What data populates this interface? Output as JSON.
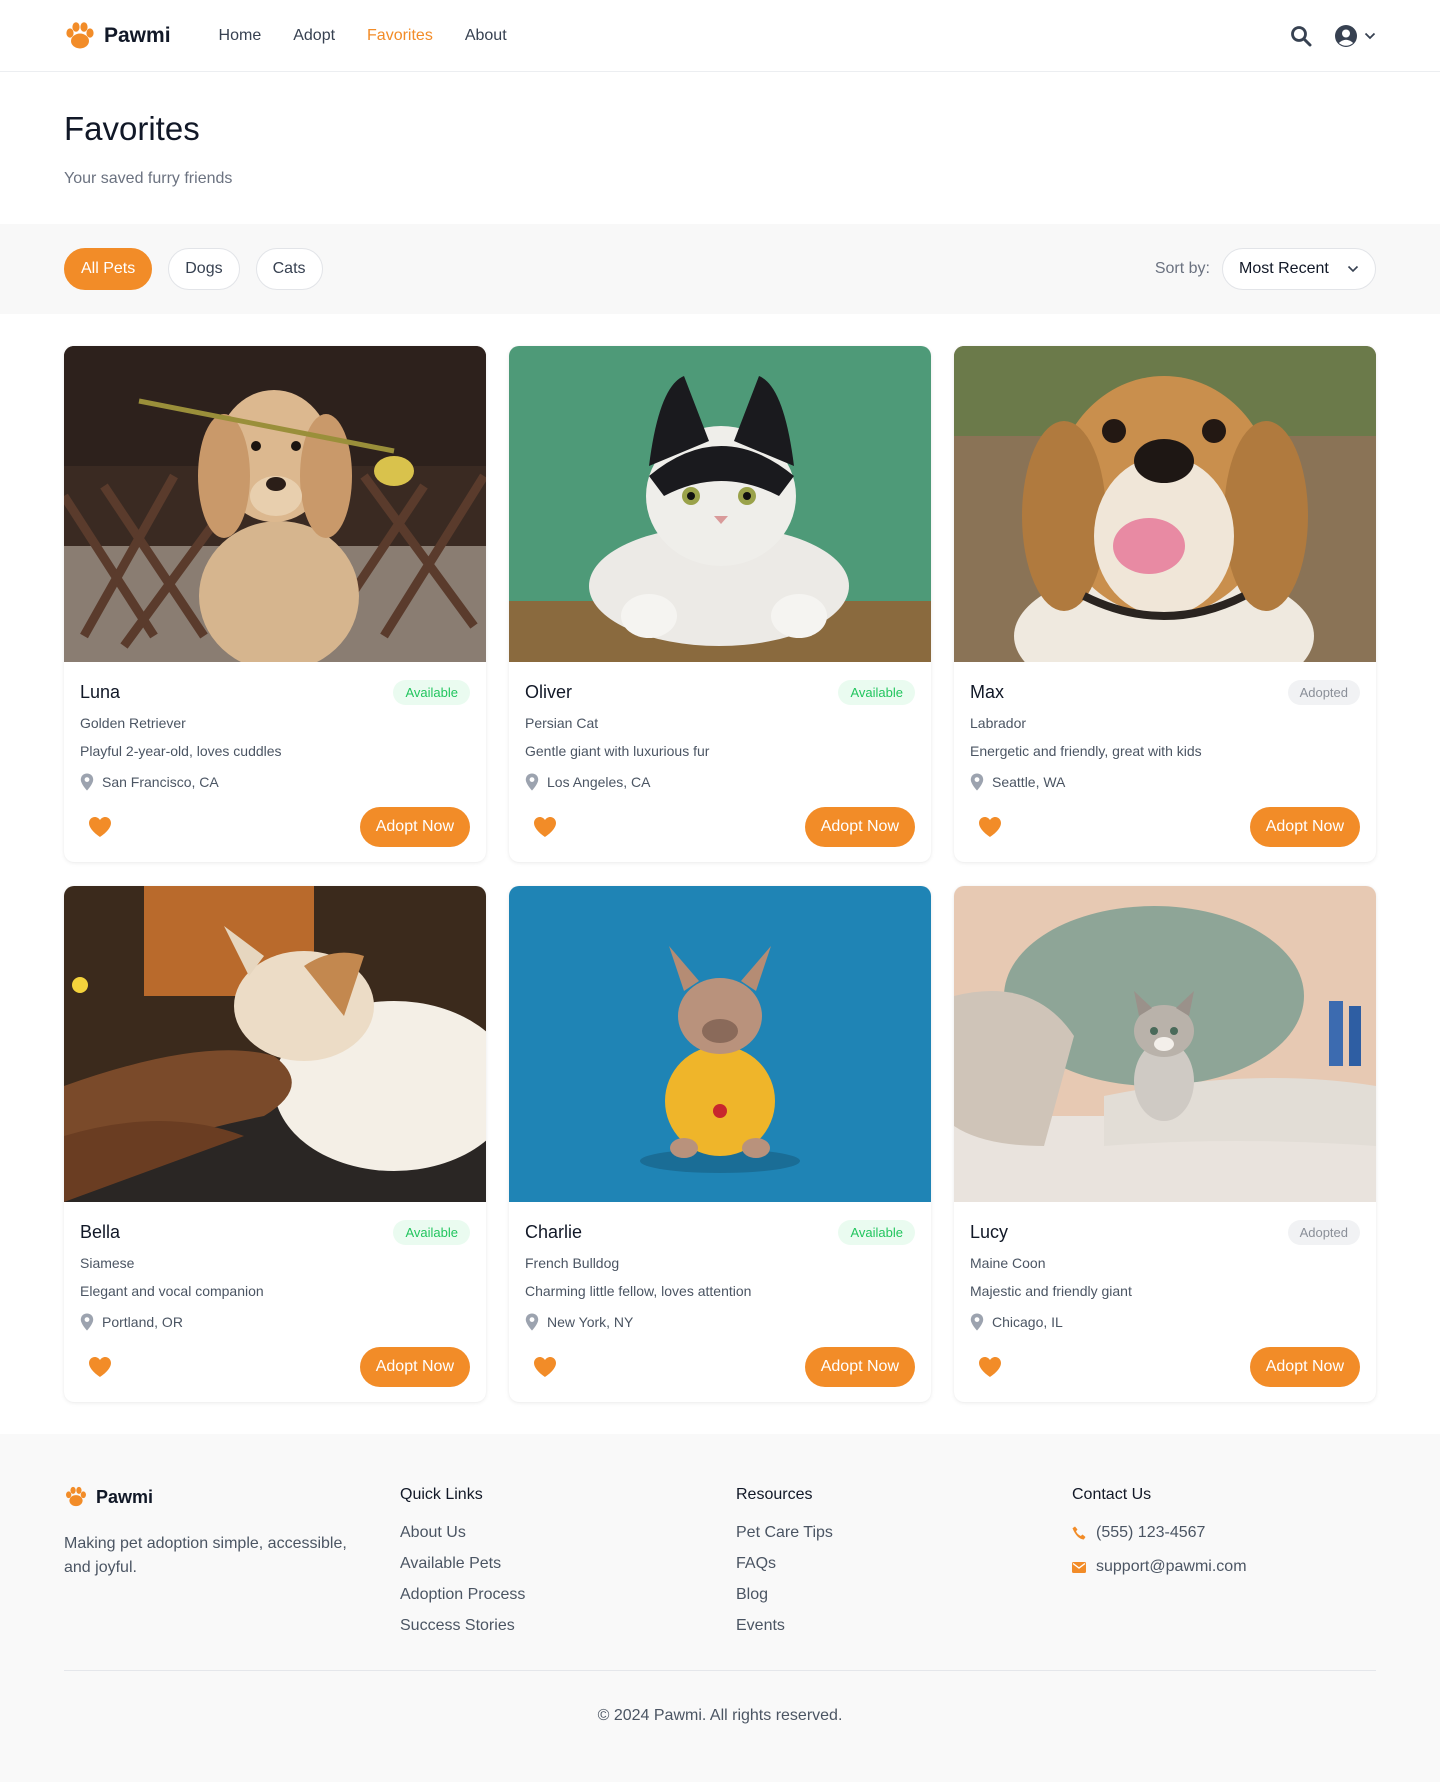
{
  "brand": {
    "name": "Pawmi",
    "accent": "#f28c28"
  },
  "nav": {
    "items": [
      "Home",
      "Adopt",
      "Favorites",
      "About"
    ],
    "active": "Favorites"
  },
  "header": {
    "search_icon": "search-icon",
    "user_icon": "user-circle-icon"
  },
  "page": {
    "title": "Favorites",
    "subtitle": "Your saved furry friends"
  },
  "filters": {
    "items": [
      "All Pets",
      "Dogs",
      "Cats"
    ],
    "active": "All Pets"
  },
  "sort": {
    "label": "Sort by:",
    "value": "Most Recent"
  },
  "pets": [
    {
      "name": "Luna",
      "status": "Available",
      "breed": "Golden Retriever",
      "description": "Playful 2-year-old, loves cuddles",
      "location": "San Francisco, CA",
      "action": "Adopt Now",
      "image": "golden-dog-with-flower"
    },
    {
      "name": "Oliver",
      "status": "Available",
      "breed": "Persian Cat",
      "description": "Gentle giant with luxurious fur",
      "location": "Los Angeles, CA",
      "action": "Adopt Now",
      "image": "black-white-cat-green-wall"
    },
    {
      "name": "Max",
      "status": "Adopted",
      "breed": "Labrador",
      "description": "Energetic and friendly, great with kids",
      "location": "Seattle, WA",
      "action": "Adopt Now",
      "image": "happy-beagle"
    },
    {
      "name": "Bella",
      "status": "Available",
      "breed": "Siamese",
      "description": "Elegant and vocal companion",
      "location": "Portland, OR",
      "action": "Adopt Now",
      "image": "cat-petted-by-hand"
    },
    {
      "name": "Charlie",
      "status": "Available",
      "breed": "French Bulldog",
      "description": "Charming little fellow, loves attention",
      "location": "New York, NY",
      "action": "Adopt Now",
      "image": "bulldog-yellow-shirt-blue-bg"
    },
    {
      "name": "Lucy",
      "status": "Adopted",
      "breed": "Maine Coon",
      "description": "Majestic and friendly giant",
      "location": "Chicago, IL",
      "action": "Adopt Now",
      "image": "kitten-on-bed"
    }
  ],
  "footer": {
    "brand": "Pawmi",
    "tagline": "Making pet adoption simple, accessible, and joyful.",
    "quick_links": {
      "heading": "Quick Links",
      "links": [
        "About Us",
        "Available Pets",
        "Adoption Process",
        "Success Stories"
      ]
    },
    "resources": {
      "heading": "Resources",
      "links": [
        "Pet Care Tips",
        "FAQs",
        "Blog",
        "Events"
      ]
    },
    "contact": {
      "heading": "Contact Us",
      "phone": "(555) 123-4567",
      "email": "support@pawmi.com"
    },
    "copyright": "© 2024 Pawmi. All rights reserved."
  }
}
